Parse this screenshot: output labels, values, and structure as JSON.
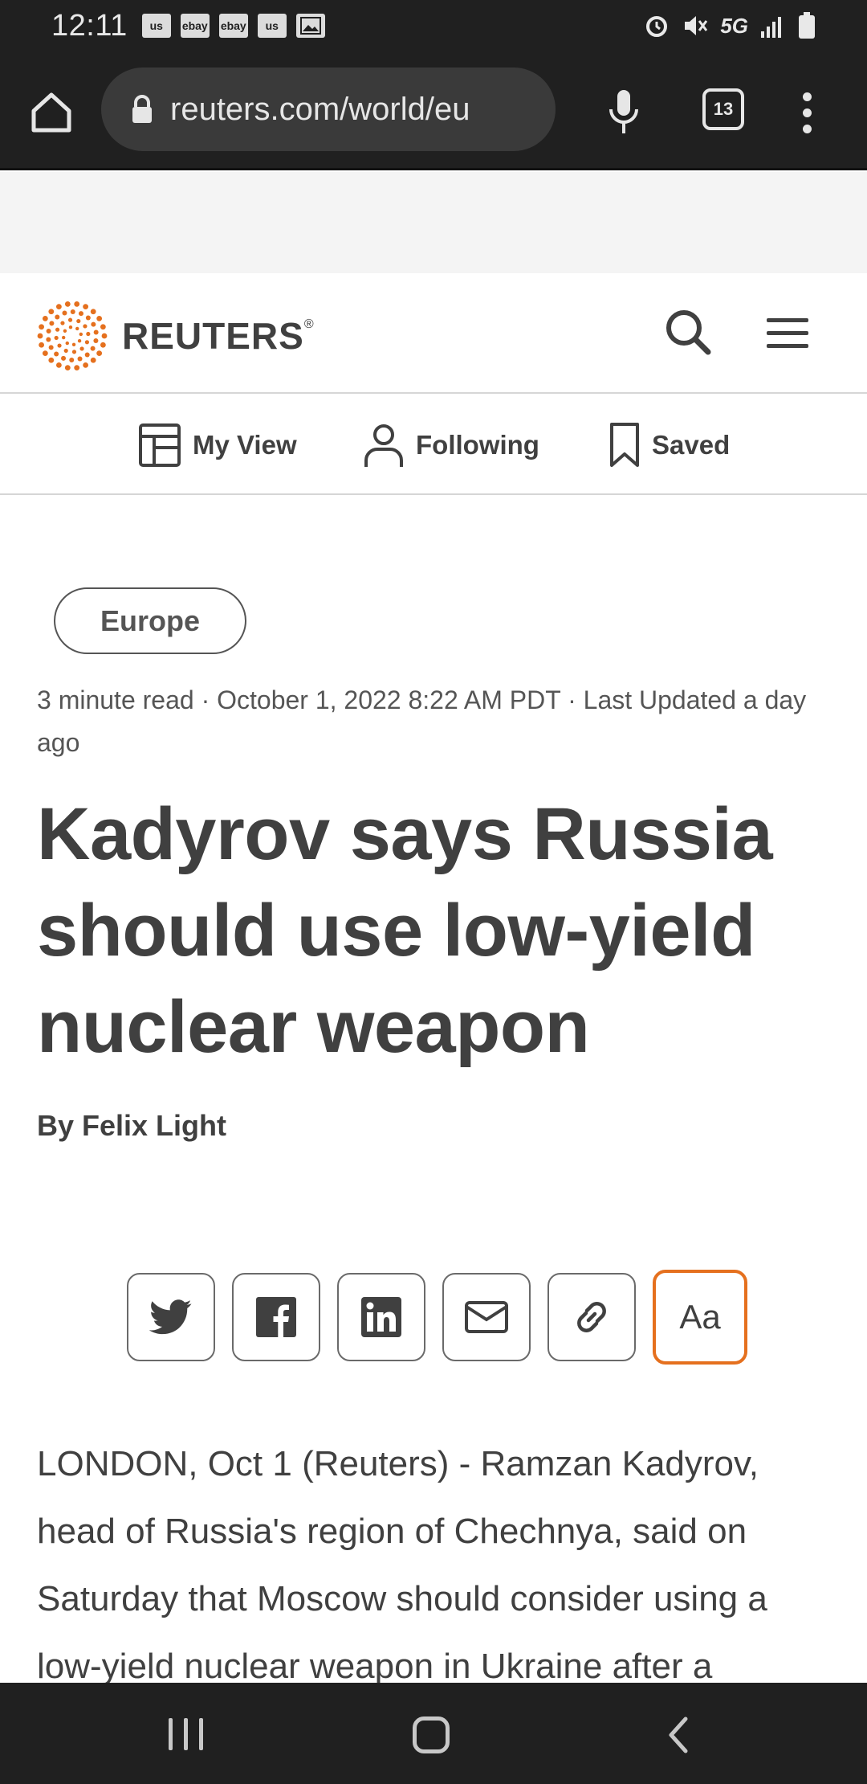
{
  "status_bar": {
    "time": "12:11",
    "notifications": [
      "us",
      "ebay",
      "ebay",
      "us",
      "image"
    ],
    "network": "5G"
  },
  "browser": {
    "url": "reuters.com/world/eu",
    "tab_count": "13"
  },
  "site": {
    "logo_text": "REUTERS",
    "logo_mark": "®",
    "brand_color": "#e5701e"
  },
  "subnav": {
    "items": [
      {
        "label": "My View",
        "icon": "layout-icon"
      },
      {
        "label": "Following",
        "icon": "person-icon"
      },
      {
        "label": "Saved",
        "icon": "bookmark-icon"
      }
    ]
  },
  "article": {
    "tag": "Europe",
    "meta": "3 minute read · October 1, 2022 8:22 AM PDT · Last Updated a day ago",
    "headline": "Kadyrov says Russia should use low-yield nuclear weapon",
    "byline": "By Felix Light",
    "share_buttons": [
      "twitter-icon",
      "facebook-icon",
      "linkedin-icon",
      "email-icon",
      "link-icon",
      "text-size-icon"
    ],
    "text_size_label": "Aa",
    "body": "LONDON, Oct 1 (Reuters) - Ramzan Kadyrov, head of Russia's region of Chechnya, said on Saturday that Moscow should consider using a low-yield nuclear weapon in Ukraine after a"
  }
}
